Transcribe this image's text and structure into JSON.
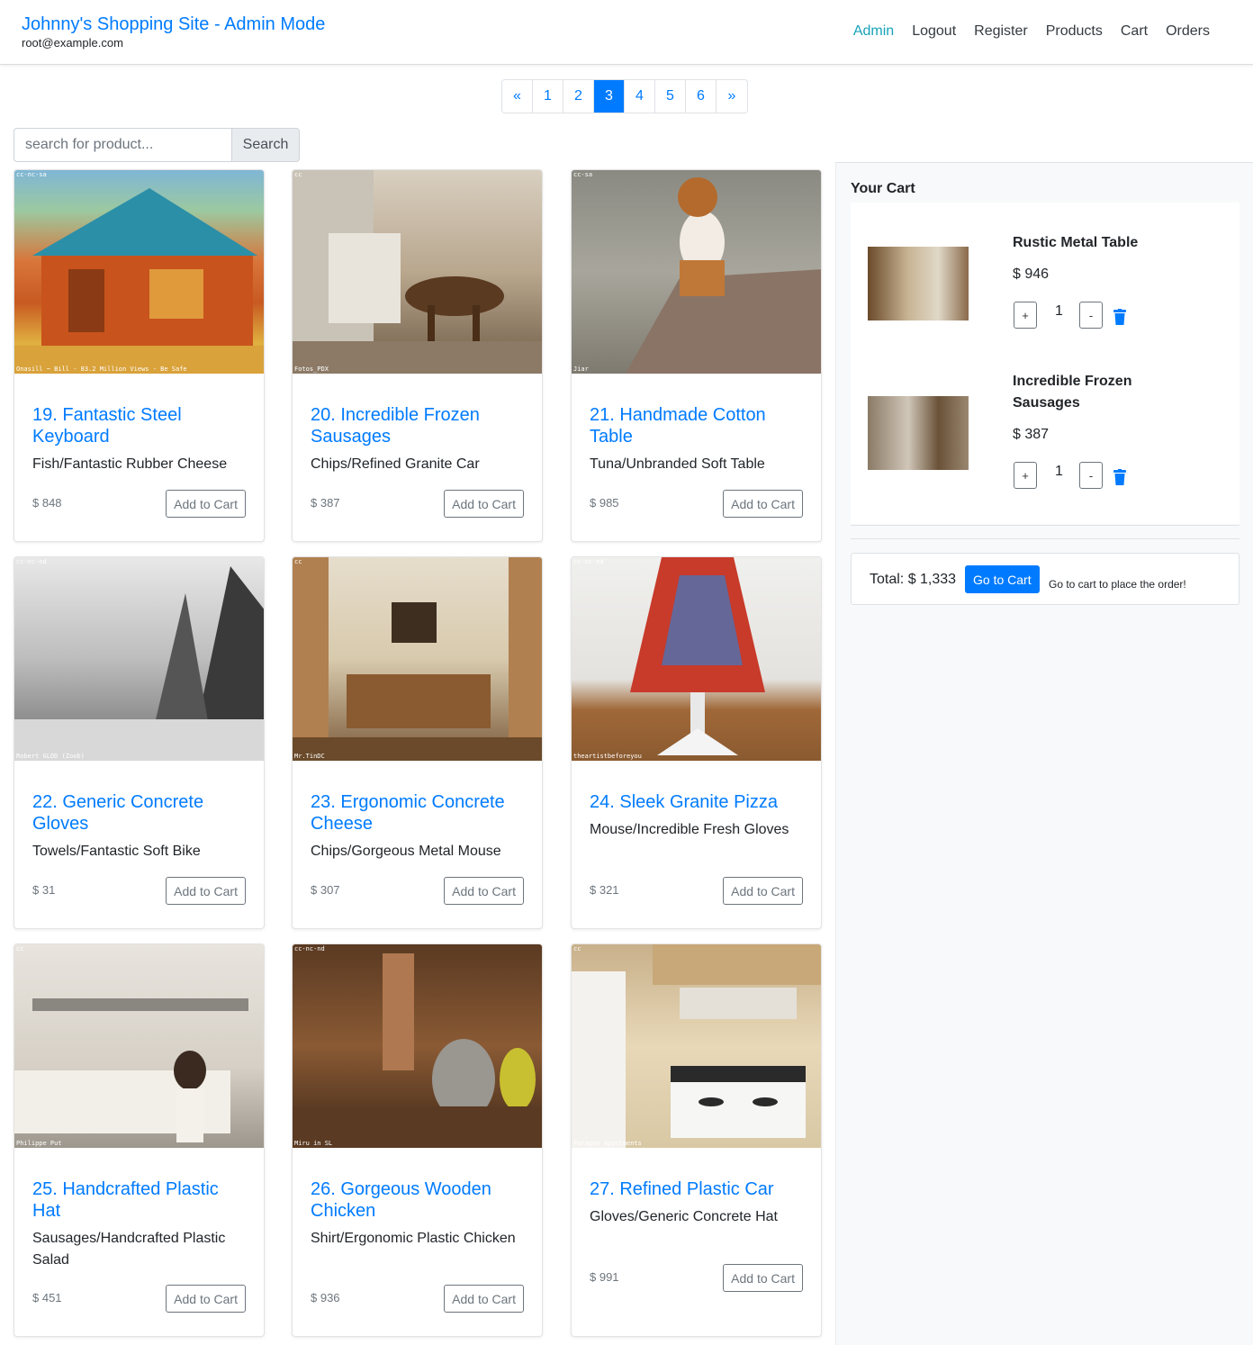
{
  "navbar": {
    "brand": "Johnny's Shopping Site - Admin Mode",
    "user": "root@example.com",
    "links": [
      "Admin",
      "Logout",
      "Register",
      "Products",
      "Cart",
      "Orders"
    ],
    "active_link": "Admin"
  },
  "pagination": {
    "prev": "«",
    "pages": [
      "1",
      "2",
      "3",
      "4",
      "5",
      "6"
    ],
    "current": "3",
    "next": "»"
  },
  "search": {
    "placeholder": "search for product...",
    "button": "Search"
  },
  "products": [
    {
      "title": "19. Fantastic Steel Keyboard",
      "category": "Fish/Fantastic Rubber Cheese",
      "price": "$ 848",
      "button": "Add to Cart",
      "watermark": "Onasill ~ Bill - 83.2 Million Views - Be Safe",
      "license": "cc-nc-sa"
    },
    {
      "title": "20. Incredible Frozen Sausages",
      "category": "Chips/Refined Granite Car",
      "price": "$ 387",
      "button": "Add to Cart",
      "watermark": "Fotos_PDX",
      "license": "cc"
    },
    {
      "title": "21. Handmade Cotton Table",
      "category": "Tuna/Unbranded Soft Table",
      "price": "$ 985",
      "button": "Add to Cart",
      "watermark": "Jiar",
      "license": "cc-sa"
    },
    {
      "title": "22. Generic Concrete Gloves",
      "category": "Towels/Fantastic Soft Bike",
      "price": "$ 31",
      "button": "Add to Cart",
      "watermark": "Robert GLOD (Zoob)",
      "license": "cc-nc-nd"
    },
    {
      "title": "23. Ergonomic Concrete Cheese",
      "category": "Chips/Gorgeous Metal Mouse",
      "price": "$ 307",
      "button": "Add to Cart",
      "watermark": "Mr.TinDC",
      "license": "cc"
    },
    {
      "title": "24. Sleek Granite Pizza",
      "category": "Mouse/Incredible Fresh Gloves",
      "price": "$ 321",
      "button": "Add to Cart",
      "watermark": "theartistbeforeyou",
      "license": "cc-nc-nd"
    },
    {
      "title": "25. Handcrafted Plastic Hat",
      "category": "Sausages/Handcrafted Plastic Salad",
      "price": "$ 451",
      "button": "Add to Cart",
      "watermark": "Philippe Put",
      "license": "cc"
    },
    {
      "title": "26. Gorgeous Wooden Chicken",
      "category": "Shirt/Ergonomic Plastic Chicken",
      "price": "$ 936",
      "button": "Add to Cart",
      "watermark": "Miru in SL",
      "license": "cc-nc-nd"
    },
    {
      "title": "27. Refined Plastic Car",
      "category": "Gloves/Generic Concrete Hat",
      "price": "$ 991",
      "button": "Add to Cart",
      "watermark": "Paragon Apartments",
      "license": "cc"
    }
  ],
  "cart": {
    "heading": "Your Cart",
    "items": [
      {
        "name": "Rustic Metal Table",
        "price": "$ 946",
        "qty": "1",
        "plus": "+",
        "minus": "-"
      },
      {
        "name": "Incredible Frozen Sausages",
        "price": "$ 387",
        "qty": "1",
        "plus": "+",
        "minus": "-"
      }
    ],
    "total": "Total: $ 1,333",
    "goto_button": "Go to Cart",
    "note": "Go to cart to place the order!"
  },
  "colors": {
    "primary": "#007bff",
    "active_nav": "#17a2b8",
    "muted": "#6c757d",
    "sidebar_bg": "#f8f9fa"
  }
}
